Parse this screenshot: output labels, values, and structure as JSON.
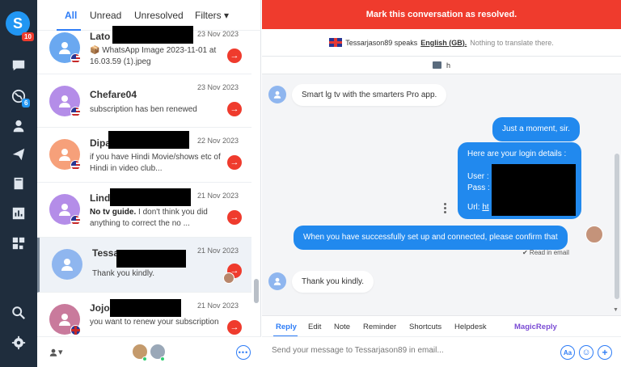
{
  "rail": {
    "logo_text": "S",
    "logo_badge": "10",
    "web_badge": "6",
    "icons": [
      "chat-icon",
      "globe-icon",
      "contacts-icon",
      "send-icon",
      "book-icon",
      "reports-icon",
      "apps-icon",
      "search-icon",
      "settings-icon"
    ]
  },
  "list": {
    "tabs": {
      "all": "All",
      "unread": "Unread",
      "unresolved": "Unresolved",
      "filters": "Filters ▾"
    },
    "conversations": [
      {
        "name": "Lato",
        "date": "23 Nov 2023",
        "message": "📦 WhatsApp Image 2023-11-01 at 16.03.59 (1).jpeg",
        "avatar_color": "#6aa8f0",
        "flag": "us"
      },
      {
        "name": "Chefare04",
        "date": "23 Nov 2023",
        "message": "subscription has ben renewed",
        "avatar_color": "#b48de8",
        "flag": "us"
      },
      {
        "name": "Dipa",
        "date": "22 Nov 2023",
        "message": "if you have Hindi Movie/shows etc of Hindi in video club...",
        "avatar_color": "#f6a07a",
        "flag": "us"
      },
      {
        "name": "Linda",
        "date": "21 Nov 2023",
        "message_bold": "No tv guide.",
        "message": " I don't think you did anything to correct the no ...",
        "avatar_color": "#b48de8",
        "flag": "us"
      },
      {
        "name": "Tessa",
        "date": "21 Nov 2023",
        "message": "Thank you kindly.",
        "avatar_color": "#8fb6ef",
        "flag": "none"
      },
      {
        "name": "Jojo",
        "date": "21 Nov 2023",
        "message": "you want to renew your subscription",
        "avatar_color": "#c97a9c",
        "flag": "gb"
      }
    ],
    "footer": {
      "agent_switch": "▾",
      "more": "•••"
    }
  },
  "pane": {
    "resolve_label": "Mark this conversation as resolved.",
    "lang": {
      "speaker": "Tessarjason89 speaks",
      "language": "English (GB).",
      "note": "Nothing to translate there."
    },
    "note_strip": "h",
    "messages": {
      "m1": "Smart lg tv with the smarters Pro app.",
      "m2": "Just a moment, sir.",
      "m3_line1": "Here are your login details :",
      "m3_user": "User :",
      "m3_pass": "Pass :",
      "m3_url": "Url: ",
      "m3_url_link": "ht",
      "m4": "When you have successfully set up and connected, please confirm that",
      "read_status": "✔ Read in email",
      "m5": "Thank you kindly."
    },
    "reply_tabs": {
      "reply": "Reply",
      "edit": "Edit",
      "note": "Note",
      "reminder": "Reminder",
      "shortcuts": "Shortcuts",
      "helpdesk": "Helpdesk",
      "magic": "MagicReply"
    },
    "composer": {
      "placeholder": "Send your message to Tessarjason89 in email...",
      "btn_aa": "Aa",
      "btn_emoji": "☺",
      "btn_add": "+"
    }
  },
  "colors": {
    "accent": "#2d7cf6",
    "resolve": "#ef3b2d",
    "outgoing": "#2189ee",
    "rail": "#1f2d3d"
  }
}
